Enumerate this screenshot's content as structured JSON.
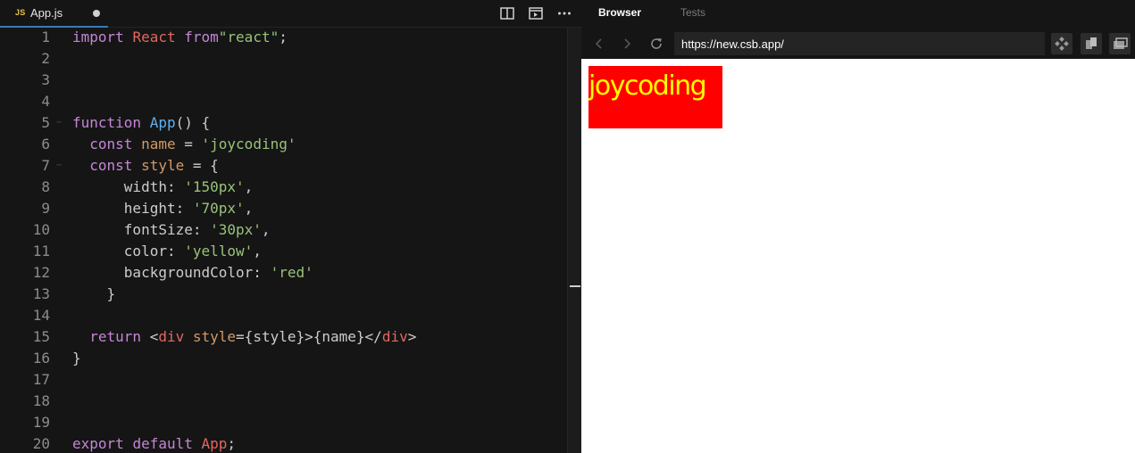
{
  "editor": {
    "tab": {
      "icon_label": "JS",
      "file_name": "App.js"
    },
    "lines": [
      {
        "n": "1",
        "tokens": [
          [
            "kw",
            "import"
          ],
          [
            "pn",
            " "
          ],
          [
            "id",
            "React"
          ],
          [
            "pn",
            " "
          ],
          [
            "kw",
            "from"
          ],
          [
            "str",
            "\"react\""
          ],
          [
            "pn",
            ";"
          ]
        ]
      },
      {
        "n": "2",
        "tokens": []
      },
      {
        "n": "3",
        "tokens": []
      },
      {
        "n": "4",
        "tokens": []
      },
      {
        "n": "5",
        "fold": true,
        "tokens": [
          [
            "kw",
            "function"
          ],
          [
            "pn",
            " "
          ],
          [
            "fn",
            "App"
          ],
          [
            "pn",
            "() {"
          ]
        ]
      },
      {
        "n": "6",
        "tokens": [
          [
            "pn",
            "  "
          ],
          [
            "kw",
            "const"
          ],
          [
            "pn",
            " "
          ],
          [
            "var",
            "name"
          ],
          [
            "pn",
            " = "
          ],
          [
            "str",
            "'joycoding'"
          ]
        ]
      },
      {
        "n": "7",
        "fold": true,
        "tokens": [
          [
            "pn",
            "  "
          ],
          [
            "kw",
            "const"
          ],
          [
            "pn",
            " "
          ],
          [
            "var",
            "style"
          ],
          [
            "pn",
            " = {"
          ]
        ]
      },
      {
        "n": "8",
        "tokens": [
          [
            "pn",
            "      "
          ],
          [
            "prop",
            "width"
          ],
          [
            "pn",
            ": "
          ],
          [
            "str",
            "'150px'"
          ],
          [
            "pn",
            ","
          ]
        ]
      },
      {
        "n": "9",
        "tokens": [
          [
            "pn",
            "      "
          ],
          [
            "prop",
            "height"
          ],
          [
            "pn",
            ": "
          ],
          [
            "str",
            "'70px'"
          ],
          [
            "pn",
            ","
          ]
        ]
      },
      {
        "n": "10",
        "tokens": [
          [
            "pn",
            "      "
          ],
          [
            "prop",
            "fontSize"
          ],
          [
            "pn",
            ": "
          ],
          [
            "str",
            "'30px'"
          ],
          [
            "pn",
            ","
          ]
        ]
      },
      {
        "n": "11",
        "tokens": [
          [
            "pn",
            "      "
          ],
          [
            "prop",
            "color"
          ],
          [
            "pn",
            ": "
          ],
          [
            "str",
            "'yellow'"
          ],
          [
            "pn",
            ","
          ]
        ]
      },
      {
        "n": "12",
        "tokens": [
          [
            "pn",
            "      "
          ],
          [
            "prop",
            "backgroundColor"
          ],
          [
            "pn",
            ": "
          ],
          [
            "str",
            "'red'"
          ]
        ]
      },
      {
        "n": "13",
        "tokens": [
          [
            "pn",
            "    }"
          ]
        ]
      },
      {
        "n": "14",
        "tokens": []
      },
      {
        "n": "15",
        "tokens": [
          [
            "pn",
            "  "
          ],
          [
            "kw",
            "return"
          ],
          [
            "pn",
            " <"
          ],
          [
            "id",
            "div"
          ],
          [
            "pn",
            " "
          ],
          [
            "var",
            "style"
          ],
          [
            "pn",
            "={style}>{name}</"
          ],
          [
            "id",
            "div"
          ],
          [
            "pn",
            ">"
          ]
        ]
      },
      {
        "n": "16",
        "tokens": [
          [
            "pn",
            "}"
          ]
        ]
      },
      {
        "n": "17",
        "tokens": []
      },
      {
        "n": "18",
        "tokens": []
      },
      {
        "n": "19",
        "tokens": []
      },
      {
        "n": "20",
        "tokens": [
          [
            "kw",
            "export"
          ],
          [
            "pn",
            " "
          ],
          [
            "kw",
            "default"
          ],
          [
            "pn",
            " "
          ],
          [
            "id",
            "App"
          ],
          [
            "pn",
            ";"
          ]
        ]
      }
    ]
  },
  "browser": {
    "tabs": {
      "browser": "Browser",
      "tests": "Tests"
    },
    "url": "https://new.csb.app/",
    "rendered_text": "joycoding"
  },
  "colors": {
    "editor_bg": "#151515",
    "keyword": "#c586d6",
    "identifier": "#e2675f",
    "function": "#61afef",
    "string": "#98c379",
    "variable": "#d19a66",
    "active_tab_underline": "#3a78b8",
    "rendered_bg": "#ff0000",
    "rendered_text": "#ffff00"
  },
  "icons": [
    "split-view-icon",
    "preview-icon",
    "more-icon",
    "back-arrow-icon",
    "forward-arrow-icon",
    "refresh-icon",
    "devtools-icon",
    "open-new-window-icon",
    "window-icon"
  ]
}
